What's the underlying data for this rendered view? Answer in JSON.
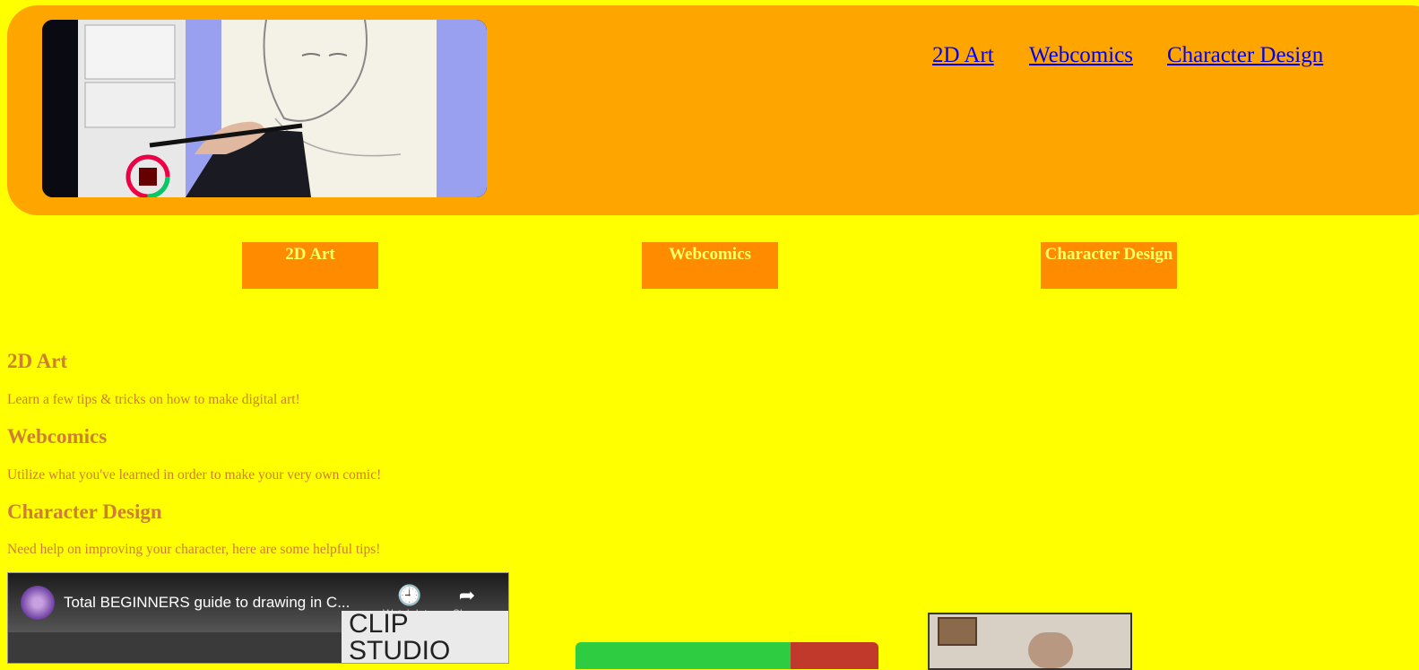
{
  "header": {
    "hero_image": "artist drawing on pen tablet in Clip Studio",
    "nav": [
      "2D Art",
      "Webcomics",
      "Character Design"
    ]
  },
  "buttons": [
    "2D Art",
    "Webcomics",
    "Character Design"
  ],
  "sections": [
    {
      "title": "2D Art",
      "text": "Learn a few tips & tricks on how to make digital art!"
    },
    {
      "title": "Webcomics",
      "text": "Utilize what you've learned in order to make your very own comic!"
    },
    {
      "title": "Character Design",
      "text": "Need help on improving your character, here are some helpful tips!"
    }
  ],
  "video": {
    "title": "Total BEGINNERS guide to drawing in C...",
    "watch_later": "Watch later",
    "share": "Share",
    "brand": "CLIP STUDIO"
  },
  "colors": {
    "page_bg": "#ffff00",
    "header_bg": "#ffa500",
    "button_bg": "#ff8c00",
    "button_text": "#ffff66",
    "section_text": "#cd7f32",
    "link": "#0000ee"
  }
}
